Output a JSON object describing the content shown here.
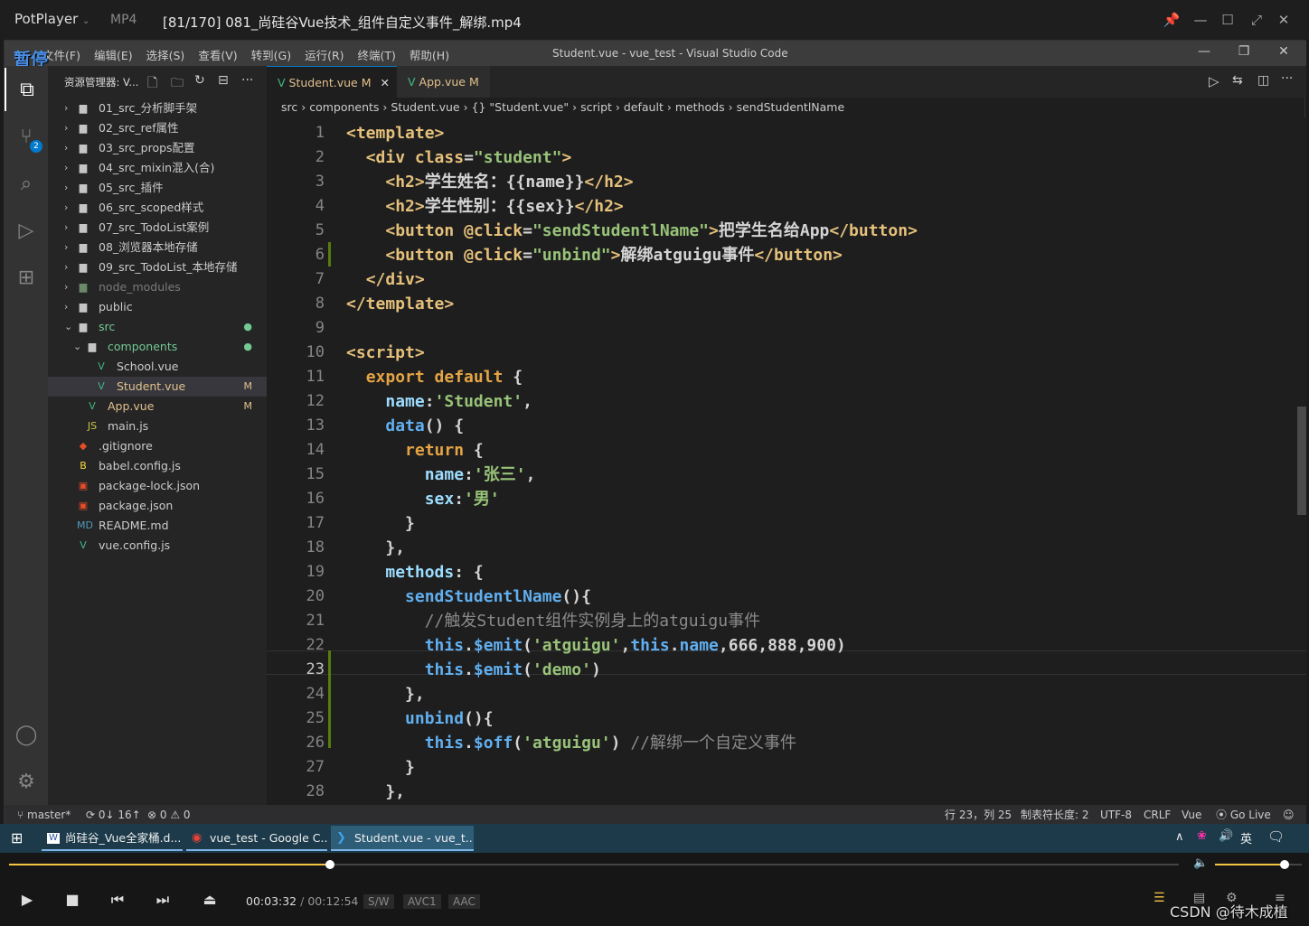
{
  "player": {
    "brand": "PotPlayer",
    "format": "MP4",
    "file_title": "[81/170] 081_尚硅谷Vue技术_组件自定义事件_解绑.mp4",
    "paused_label": "暂停",
    "time_current": "00:03:32",
    "time_sep": "/",
    "time_total": "00:12:54",
    "tags": [
      "S/W",
      "AVC1",
      "AAC"
    ],
    "progress_fraction": 0.274,
    "volume_fraction": 0.8,
    "watermark": "CSDN @待木成植"
  },
  "vscode": {
    "menu": [
      "文件(F)",
      "编辑(E)",
      "选择(S)",
      "查看(V)",
      "转到(G)",
      "运行(R)",
      "终端(T)",
      "帮助(H)"
    ],
    "window_title": "Student.vue - vue_test - Visual Studio Code",
    "explorer_title": "资源管理器: V...",
    "scm_badge": "2",
    "tree": [
      {
        "label": "01_src_分析脚手架",
        "type": "folder",
        "depth": 0,
        "open": false
      },
      {
        "label": "02_src_ref属性",
        "type": "folder",
        "depth": 0,
        "open": false
      },
      {
        "label": "03_src_props配置",
        "type": "folder",
        "depth": 0,
        "open": false
      },
      {
        "label": "04_src_mixin混入(合)",
        "type": "folder",
        "depth": 0,
        "open": false
      },
      {
        "label": "05_src_插件",
        "type": "folder",
        "depth": 0,
        "open": false
      },
      {
        "label": "06_src_scoped样式",
        "type": "folder",
        "depth": 0,
        "open": false
      },
      {
        "label": "07_src_TodoList案例",
        "type": "folder",
        "depth": 0,
        "open": false
      },
      {
        "label": "08_浏览器本地存储",
        "type": "folder",
        "depth": 0,
        "open": false
      },
      {
        "label": "09_src_TodoList_本地存储",
        "type": "folder",
        "depth": 0,
        "open": false
      },
      {
        "label": "node_modules",
        "type": "folder-dim",
        "depth": 0,
        "open": false
      },
      {
        "label": "public",
        "type": "folder",
        "depth": 0,
        "open": false
      },
      {
        "label": "src",
        "type": "folder-mod",
        "depth": 0,
        "open": true,
        "status": "●"
      },
      {
        "label": "components",
        "type": "folder-mod",
        "depth": 1,
        "open": true,
        "status": "●"
      },
      {
        "label": "School.vue",
        "type": "vue",
        "depth": 2
      },
      {
        "label": "Student.vue",
        "type": "vue-mod",
        "depth": 2,
        "status": "M",
        "selected": true
      },
      {
        "label": "App.vue",
        "type": "vue-mod",
        "depth": 1,
        "status": "M"
      },
      {
        "label": "main.js",
        "type": "js",
        "depth": 1
      },
      {
        "label": ".gitignore",
        "type": "git",
        "depth": 0
      },
      {
        "label": "babel.config.js",
        "type": "babel",
        "depth": 0
      },
      {
        "label": "package-lock.json",
        "type": "json",
        "depth": 0
      },
      {
        "label": "package.json",
        "type": "json",
        "depth": 0
      },
      {
        "label": "README.md",
        "type": "md",
        "depth": 0
      },
      {
        "label": "vue.config.js",
        "type": "vue",
        "depth": 0
      }
    ],
    "tabs": [
      {
        "label": "Student.vue",
        "status": "M",
        "active": true
      },
      {
        "label": "App.vue",
        "status": "M",
        "active": false
      }
    ],
    "breadcrumb": [
      "src",
      "components",
      "Student.vue",
      "{} \"Student.vue\"",
      "script",
      "default",
      "methods",
      "sendStudentlName"
    ],
    "code_lines": [
      [
        [
          "t",
          "<template>"
        ]
      ],
      [
        [
          "p",
          "  "
        ],
        [
          "t",
          "<div "
        ],
        [
          "at",
          "class"
        ],
        [
          "p",
          "="
        ],
        [
          "s",
          "\"student\""
        ],
        [
          "t",
          ">"
        ]
      ],
      [
        [
          "p",
          "    "
        ],
        [
          "t",
          "<h2>"
        ],
        [
          "p",
          "学生姓名：{{name}}"
        ],
        [
          "t",
          "</h2>"
        ]
      ],
      [
        [
          "p",
          "    "
        ],
        [
          "t",
          "<h2>"
        ],
        [
          "p",
          "学生性别：{{sex}}"
        ],
        [
          "t",
          "</h2>"
        ]
      ],
      [
        [
          "p",
          "    "
        ],
        [
          "t",
          "<button "
        ],
        [
          "at",
          "@click"
        ],
        [
          "p",
          "="
        ],
        [
          "s",
          "\"sendStudentlName\""
        ],
        [
          "t",
          ">"
        ],
        [
          "p",
          "把学生名给App"
        ],
        [
          "t",
          "</button>"
        ]
      ],
      [
        [
          "p",
          "    "
        ],
        [
          "t",
          "<button "
        ],
        [
          "at",
          "@click"
        ],
        [
          "p",
          "="
        ],
        [
          "s",
          "\"unbind\""
        ],
        [
          "t",
          ">"
        ],
        [
          "p",
          "解绑atguigu事件"
        ],
        [
          "t",
          "</button>"
        ]
      ],
      [
        [
          "p",
          "  "
        ],
        [
          "t",
          "</div>"
        ]
      ],
      [
        [
          "t",
          "</template>"
        ]
      ],
      [
        [
          "p",
          ""
        ]
      ],
      [
        [
          "t",
          "<script>"
        ]
      ],
      [
        [
          "p",
          "  "
        ],
        [
          "kw",
          "export default"
        ],
        [
          "p",
          " {"
        ]
      ],
      [
        [
          "p",
          "    "
        ],
        [
          "v",
          "name"
        ],
        [
          "p",
          ":"
        ],
        [
          "s",
          "'Student'"
        ],
        [
          "p",
          ","
        ]
      ],
      [
        [
          "p",
          "    "
        ],
        [
          "f",
          "data"
        ],
        [
          "p",
          "() {"
        ]
      ],
      [
        [
          "p",
          "      "
        ],
        [
          "kw",
          "return"
        ],
        [
          "p",
          " {"
        ]
      ],
      [
        [
          "p",
          "        "
        ],
        [
          "v",
          "name"
        ],
        [
          "p",
          ":"
        ],
        [
          "s",
          "'张三'"
        ],
        [
          "p",
          ","
        ]
      ],
      [
        [
          "p",
          "        "
        ],
        [
          "v",
          "sex"
        ],
        [
          "p",
          ":"
        ],
        [
          "s",
          "'男'"
        ]
      ],
      [
        [
          "p",
          "      }"
        ]
      ],
      [
        [
          "p",
          "    },"
        ]
      ],
      [
        [
          "p",
          "    "
        ],
        [
          "v",
          "methods"
        ],
        [
          "p",
          ": {"
        ]
      ],
      [
        [
          "p",
          "      "
        ],
        [
          "f",
          "sendStudentlName"
        ],
        [
          "p",
          "(){"
        ]
      ],
      [
        [
          "p",
          "        "
        ],
        [
          "c",
          "//触发Student组件实例身上的atguigu事件"
        ]
      ],
      [
        [
          "p",
          "        "
        ],
        [
          "f",
          "this"
        ],
        [
          "p",
          "."
        ],
        [
          "f",
          "$emit"
        ],
        [
          "p",
          "("
        ],
        [
          "s",
          "'atguigu'"
        ],
        [
          "p",
          ","
        ],
        [
          "f",
          "this"
        ],
        [
          "p",
          "."
        ],
        [
          "f",
          "name"
        ],
        [
          "p",
          ",666,888,900)"
        ]
      ],
      [
        [
          "p",
          "        "
        ],
        [
          "f",
          "this"
        ],
        [
          "p",
          "."
        ],
        [
          "f",
          "$emit"
        ],
        [
          "p",
          "("
        ],
        [
          "s",
          "'demo'"
        ],
        [
          "p",
          ")"
        ]
      ],
      [
        [
          "p",
          "      },"
        ]
      ],
      [
        [
          "p",
          "      "
        ],
        [
          "f",
          "unbind"
        ],
        [
          "p",
          "(){"
        ]
      ],
      [
        [
          "p",
          "        "
        ],
        [
          "f",
          "this"
        ],
        [
          "p",
          "."
        ],
        [
          "f",
          "$off"
        ],
        [
          "p",
          "("
        ],
        [
          "s",
          "'atguigu'"
        ],
        [
          "p",
          ") "
        ],
        [
          "c",
          "//解绑一个自定义事件"
        ]
      ],
      [
        [
          "p",
          "      }"
        ]
      ],
      [
        [
          "p",
          "    },"
        ]
      ]
    ],
    "line_numbers": [
      "1",
      "2",
      "3",
      "4",
      "5",
      "6",
      "7",
      "8",
      "9",
      "10",
      "11",
      "12",
      "13",
      "14",
      "15",
      "16",
      "17",
      "18",
      "19",
      "20",
      "21",
      "22",
      "23",
      "24",
      "25",
      "26",
      "27",
      "28"
    ],
    "current_line": "23",
    "status": {
      "branch": "master*",
      "sync": "0↓ 16↑",
      "problems": "⊗ 0 ⚠ 0",
      "position": "行 23，列 25",
      "tab_size": "制表符长度: 2",
      "encoding": "UTF-8",
      "eol": "CRLF",
      "language": "Vue",
      "golive": "Go Live"
    }
  },
  "taskbar": {
    "items": [
      "尚硅谷_Vue全家桶.d...",
      "vue_test - Google C...",
      "Student.vue - vue_t..."
    ],
    "ime": "英"
  },
  "colors": {
    "accent": "#007acc",
    "progress": "#f5c542"
  }
}
